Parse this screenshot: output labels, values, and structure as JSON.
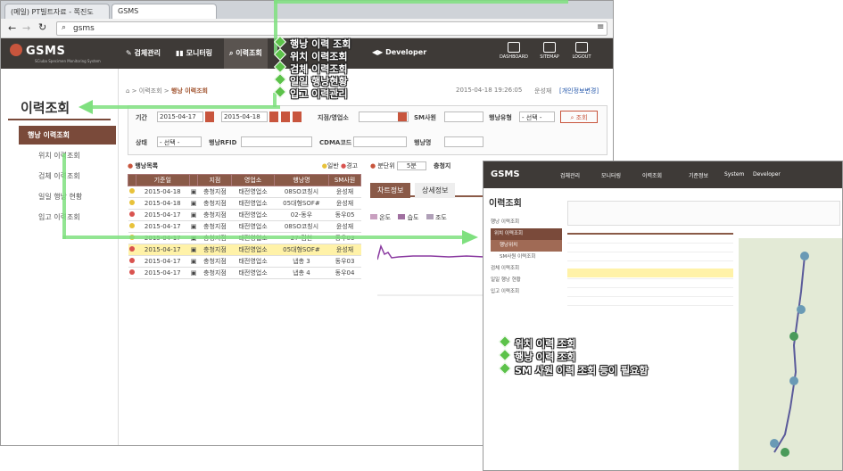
{
  "browser": {
    "tabs": [
      "(메일) PT빌트자료 - 쪽진도",
      "GSMS"
    ],
    "url": "gsms"
  },
  "gnb": {
    "logo": "GSMS",
    "logo_sub": "SCiuba Specimen Monitoring System",
    "menus": [
      "검체관리",
      "모니터링",
      "이력조회",
      "Developer"
    ],
    "right": [
      "DASHBOARD",
      "SITEMAP",
      "LOGOUT"
    ]
  },
  "lnb": {
    "title": "이력조회",
    "items": [
      "행낭 이력조회",
      "위치 이력조회",
      "검체 이력조회",
      "일일 행낭 현황",
      "입고 이력조회"
    ]
  },
  "breadcrumb": {
    "home": "이력조회",
    "current": "행낭 이력조회",
    "time": "2015-04-18 19:26:05",
    "user": "운성재",
    "link": "[개인정보변경]"
  },
  "search": {
    "period_label": "기간",
    "start": "2015-04-17",
    "end": "2015-04-18",
    "store_label": "지점/영업소",
    "sm_label": "SM사원",
    "type_label": "행낭유형",
    "type_value": "- 선택 -",
    "search_btn": "조회",
    "status_label": "상태",
    "status_value": "- 선택 -",
    "rfid_label": "행낭RFID",
    "cdma_label": "CDMA코드",
    "bag_label": "행낭명"
  },
  "list": {
    "title": "행낭목록",
    "legend": [
      "일반",
      "경고"
    ],
    "headers": [
      "",
      "기준일",
      "",
      "지점",
      "영업소",
      "행낭명",
      "SM사원"
    ],
    "rows": [
      {
        "c": "#e8c23a",
        "d": "2015-04-18",
        "s": "충청지점",
        "o": "태전영업소",
        "b": "08SO코칭시",
        "m": "윤성재"
      },
      {
        "c": "#e8c23a",
        "d": "2015-04-18",
        "s": "충청지점",
        "o": "태전영업소",
        "b": "05대형SOF#",
        "m": "윤성재"
      },
      {
        "c": "#d9534f",
        "d": "2015-04-17",
        "s": "충청지점",
        "o": "태전영업소",
        "b": "02-동우",
        "m": "동우05"
      },
      {
        "c": "#e8c23a",
        "d": "2015-04-17",
        "s": "충청지점",
        "o": "태전영업소",
        "b": "08SO코칭시",
        "m": "윤성재"
      },
      {
        "c": "#e8c23a",
        "d": "2015-04-17",
        "s": "충청지점",
        "o": "태전영업소",
        "b": "27-김천",
        "m": "동우03"
      },
      {
        "c": "#d9534f",
        "d": "2015-04-17",
        "s": "충청지점",
        "o": "태전영업소",
        "b": "05대형SOF#",
        "m": "윤성재",
        "hl": true
      },
      {
        "c": "#d9534f",
        "d": "2015-04-17",
        "s": "충청지점",
        "o": "태전영업소",
        "b": "냅총 3",
        "m": "동우03"
      },
      {
        "c": "#d9534f",
        "d": "2015-04-17",
        "s": "충청지점",
        "o": "태전영업소",
        "b": "냅총 4",
        "m": "동우04"
      }
    ]
  },
  "chart": {
    "unit_label": "분단위",
    "unit_value": "5분",
    "extra": "충청지",
    "tabs": [
      "차트정보",
      "상세정보"
    ],
    "legend": [
      "온도",
      "습도",
      "조도"
    ]
  },
  "overlay": {
    "menus": [
      "검체관리",
      "모니터링",
      "이력조회",
      "기준정보",
      "System",
      "Developer"
    ],
    "lnb": [
      "행낭 이력조회",
      "위치 이력조회",
      "행낭위치",
      "SM사원 이력조회",
      "검체 이력조회",
      "일일 행낭 현황",
      "입고 이력조회"
    ]
  },
  "annotations_top": [
    "행낭 이력 조회",
    "위치 이력조회",
    "검체 이력조회",
    "일일 행낭현황",
    "입고 이력관리"
  ],
  "annotations_bottom": [
    "위치 이력 조회",
    "행낭 이력 조회",
    "SM 사원 이력 조회 등이 필요함"
  ]
}
